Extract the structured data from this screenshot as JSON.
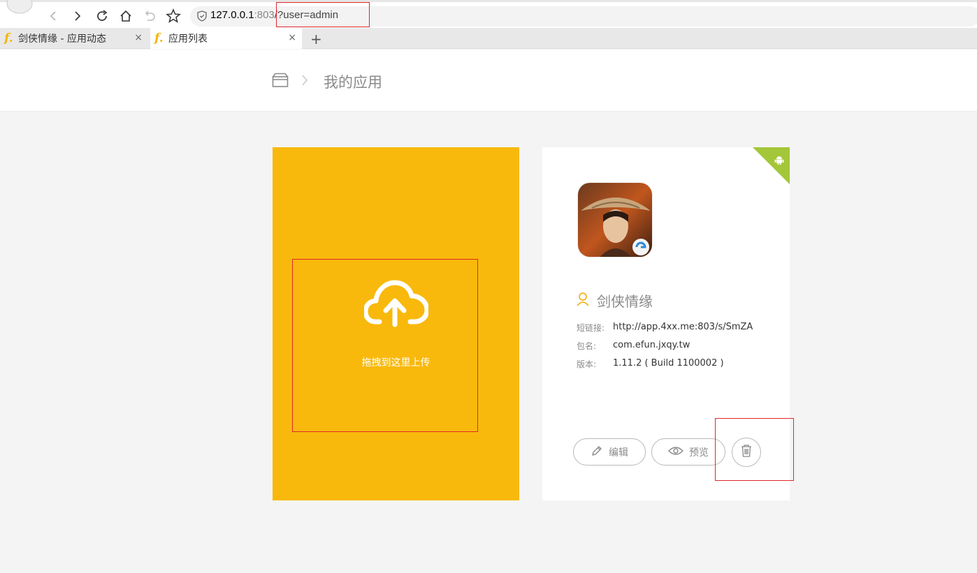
{
  "browser": {
    "url_host": "127.0.0.1",
    "url_port": ":803",
    "url_path": "/?user=admin",
    "tabs": [
      {
        "icon": "f.",
        "title": "剑侠情缘 - 应用动态",
        "close": "×"
      },
      {
        "icon": "f.",
        "title": "应用列表",
        "close": "×"
      }
    ],
    "new_tab": "+"
  },
  "header": {
    "breadcrumb_title": "我的应用"
  },
  "upload": {
    "label": "拖拽到这里上传"
  },
  "app": {
    "name": "剑侠情缘",
    "platform": "android",
    "short_link_label": "短链接:",
    "short_link": "http://app.4xx.me:803/s/SmZA",
    "package_label": "包名:",
    "package": "com.efun.jxqy.tw",
    "version_label": "版本:",
    "version": "1.11.2 ( Build 1100002 )",
    "edit_label": "编辑",
    "preview_label": "预览"
  },
  "colors": {
    "upload_bg": "#f8b90c",
    "android_tag": "#a4c639",
    "highlight": "#e0282a"
  }
}
